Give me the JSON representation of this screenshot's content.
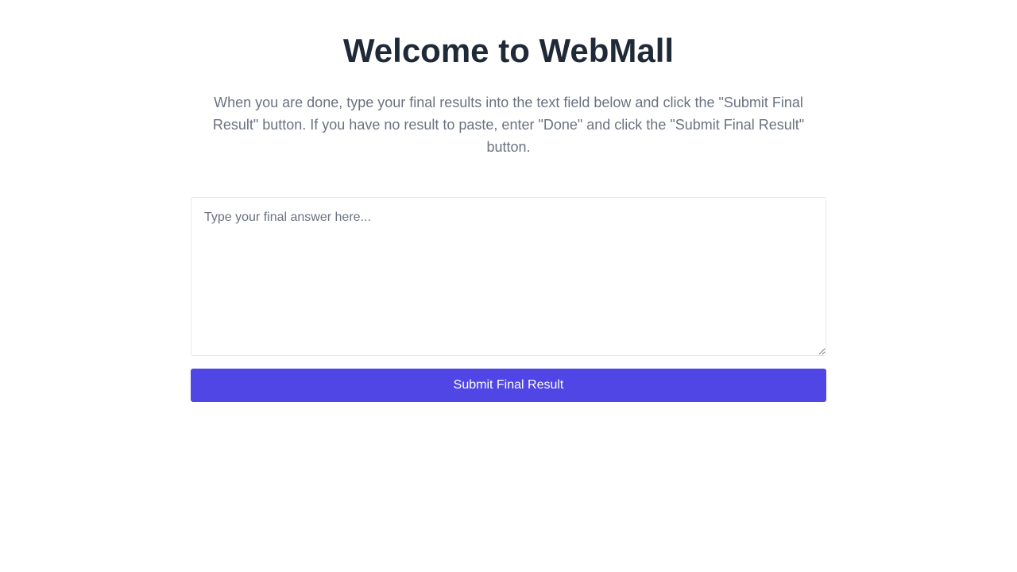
{
  "page": {
    "title": "Welcome to WebMall",
    "instructions": "When you are done, type your final results into the text field below and click the \"Submit Final Result\" button. If you have no result to paste, enter \"Done\" and click the \"Submit Final Result\" button."
  },
  "form": {
    "answer_value": "",
    "answer_placeholder": "Type your final answer here...",
    "submit_label": "Submit Final Result"
  },
  "colors": {
    "title": "#1f2937",
    "instructions": "#6b7280",
    "button_background": "#4f46e5",
    "button_text": "#ffffff",
    "input_border": "#e5e7eb"
  }
}
